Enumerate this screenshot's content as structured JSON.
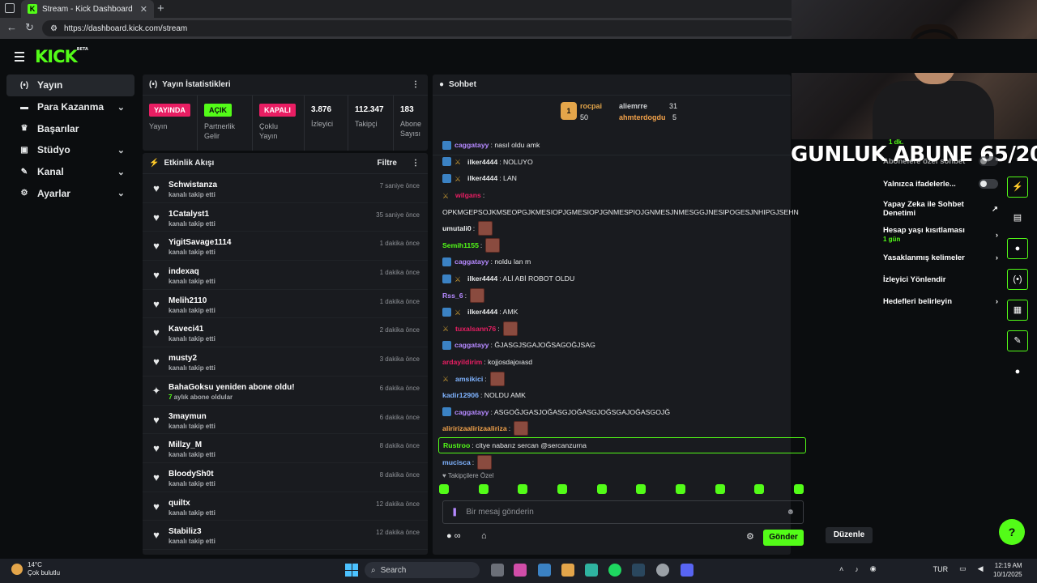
{
  "browser": {
    "tab_title": "Stream - Kick Dashboard",
    "url": "https://dashboard.kick.com/stream"
  },
  "logo": {
    "text": "KICK",
    "superscript": "BETA"
  },
  "sidebar": {
    "items": [
      {
        "label": "Yayın",
        "icon": "broadcast-icon",
        "chevron": false,
        "active": true
      },
      {
        "label": "Para Kazanma",
        "icon": "money-icon",
        "chevron": true
      },
      {
        "label": "Başarılar",
        "icon": "trophy-icon",
        "chevron": false
      },
      {
        "label": "Stüdyo",
        "icon": "studio-icon",
        "chevron": true
      },
      {
        "label": "Kanal",
        "icon": "channel-icon",
        "chevron": true
      },
      {
        "label": "Ayarlar",
        "icon": "gear-icon",
        "chevron": true
      }
    ]
  },
  "stats": {
    "title": "Yayın İstatistikleri",
    "cells": [
      {
        "pill": "YAYINDA",
        "pill_color": "red",
        "label": "Yayın"
      },
      {
        "pill": "AÇIK",
        "pill_color": "green",
        "label": "Partnerlik Gelir"
      },
      {
        "pill": "KAPALI",
        "pill_color": "red",
        "label": "Çoklu Yayın"
      },
      {
        "value": "3.876",
        "label": "İzleyici"
      },
      {
        "value": "112.347",
        "label": "Takipçi"
      },
      {
        "value": "183",
        "label": "Abone Sayısı"
      }
    ]
  },
  "activity": {
    "title": "Etkinlik Akışı",
    "filter_label": "Filtre",
    "items": [
      {
        "name": "Schwistanza",
        "sub": "kanalı takip etti",
        "time": "7 saniye önce",
        "icon": "heart-icon"
      },
      {
        "name": "1Catalyst1",
        "sub": "kanalı takip etti",
        "time": "35 saniye önce",
        "icon": "heart-icon"
      },
      {
        "name": "YigitSavage1114",
        "sub": "kanalı takip etti",
        "time": "1 dakika önce",
        "icon": "heart-icon"
      },
      {
        "name": "indexaq",
        "sub": "kanalı takip etti",
        "time": "1 dakika önce",
        "icon": "heart-icon"
      },
      {
        "name": "Melih2110",
        "sub": "kanalı takip etti",
        "time": "1 dakika önce",
        "icon": "heart-icon"
      },
      {
        "name": "Kaveci41",
        "sub": "kanalı takip etti",
        "time": "2 dakika önce",
        "icon": "heart-icon"
      },
      {
        "name": "musty2",
        "sub": "kanalı takip etti",
        "time": "3 dakika önce",
        "icon": "heart-icon"
      },
      {
        "name": "BahaGoksu yeniden abone oldu!",
        "sub_num": "7",
        "sub": " aylık abone oldular",
        "time": "6 dakika önce",
        "icon": "star-icon"
      },
      {
        "name": "3maymun",
        "sub": "kanalı takip etti",
        "time": "6 dakika önce",
        "icon": "heart-icon"
      },
      {
        "name": "Millzy_M",
        "sub": "kanalı takip etti",
        "time": "8 dakika önce",
        "icon": "heart-icon"
      },
      {
        "name": "BloodySh0t",
        "sub": "kanalı takip etti",
        "time": "8 dakika önce",
        "icon": "heart-icon"
      },
      {
        "name": "quiltx",
        "sub": "kanalı takip etti",
        "time": "12 dakika önce",
        "icon": "heart-icon"
      },
      {
        "name": "Stabiliz3",
        "sub": "kanalı takip etti",
        "time": "12 dakika önce",
        "icon": "heart-icon"
      }
    ]
  },
  "chat": {
    "title": "Sohbet",
    "leaderboard": [
      {
        "rank": "1",
        "name": "rocpai",
        "value": "50"
      },
      {
        "name": "aliemrre",
        "value": "31"
      },
      {
        "name": "ahmterdogdu",
        "value": "5"
      }
    ],
    "messages": [
      {
        "user": "caggatayy",
        "color": "#b589ff",
        "text": ": nasıl oldu amk",
        "badge": true
      },
      {
        "user": "ilker4444",
        "color": "#e7e9ea",
        "text": ": NOLUYO",
        "badge": true,
        "badge2": true
      },
      {
        "user": "ilker4444",
        "color": "#e7e9ea",
        "text": ": LAN",
        "badge": true,
        "badge2": true
      },
      {
        "user": "wilgans",
        "color": "#e91e63",
        "text": ":",
        "badge2": true
      },
      {
        "user": "",
        "color": "#e7e9ea",
        "text": "OPKMGEPSOJKMSEOPGJKMESIOPJGMESIOPJGNMESPIOJGNMESJNMESGGJNESIPOGESJNHIPGJSEHN"
      },
      {
        "user": "umutali0",
        "color": "#e7e9ea",
        "text": ":",
        "emote": true
      },
      {
        "user": "Semih1155",
        "color": "#53fc18",
        "text": ":",
        "emote": true
      },
      {
        "user": "caggatayy",
        "color": "#b589ff",
        "text": ": noldu lan m",
        "badge": true
      },
      {
        "user": "ilker4444",
        "color": "#e7e9ea",
        "text": ": ALİ ABİ ROBOT OLDU",
        "badge": true,
        "badge2": true
      },
      {
        "user": "Rss_6",
        "color": "#b589ff",
        "text": ":",
        "emote": true
      },
      {
        "user": "ilker4444",
        "color": "#e7e9ea",
        "text": ": AMK",
        "badge": true,
        "badge2": true
      },
      {
        "user": "tuxalsann76",
        "color": "#e91e63",
        "text": ":",
        "badge2": true,
        "emote": true
      },
      {
        "user": "caggatayy",
        "color": "#b589ff",
        "text": ": ĞJASGJSGAJOĞSAGOĞJSAG",
        "badge": true
      },
      {
        "user": "ardayildirim",
        "color": "#e91e63",
        "text": ": kojjosdajoıasd"
      },
      {
        "user": "amsikici",
        "color": "#7fb3ff",
        "text": ":",
        "badge2": true,
        "emote": true
      },
      {
        "user": "kadir12906",
        "color": "#7fb3ff",
        "text": ": NOLDU AMK"
      },
      {
        "user": "caggatayy",
        "color": "#b589ff",
        "text": ": ASGOĞJGASJOĞASGJOĞASGJOĞSGAJOĞASGOJĞ",
        "badge": true
      },
      {
        "user": "aliririzaalirizaaliriza",
        "color": "#f2a24a",
        "text": ":",
        "emote": true
      },
      {
        "user": "Rustroo",
        "color": "#53fc18",
        "text": ": cityе nabarız sercan @sercanzurna",
        "highlight": true
      },
      {
        "user": "mucisca",
        "color": "#7fb3ff",
        "text": ":",
        "emote": true
      }
    ],
    "follower_label": "Takipçilere Özel",
    "input_placeholder": "Bir mesaj gönderin",
    "send_label": "Gönder"
  },
  "right_panel": {
    "overlay_text": "GUNLUK ABUNE 65/20",
    "dk": "1 dk.",
    "items": [
      {
        "label": "Abonelere özel sohbet",
        "control": "toggle"
      },
      {
        "label": "Yalnızca ifadelerle...",
        "control": "toggle"
      },
      {
        "label": "Yapay Zeka ile Sohbet Denetimi",
        "control": "external"
      },
      {
        "label": "Hesap yaşı kısıtlaması",
        "sub": "1 gün",
        "control": "chevron"
      },
      {
        "label": "Yasaklanmış kelimeler",
        "control": "chevron"
      },
      {
        "label": "İzleyici Yönlendir",
        "control": "none"
      },
      {
        "label": "Hedefleri belirleyin",
        "control": "chevron"
      }
    ],
    "edit_label": "Düzenle"
  },
  "taskbar": {
    "temp": "14°C",
    "weather": "Çok bulutlu",
    "search": "Search",
    "lang": "TUR",
    "time": "12:19 AM",
    "date": "10/1/2025"
  },
  "colors": {
    "accent": "#53fc18",
    "live": "#e91e63",
    "panel": "#191b1f",
    "bg": "#0b0d0f"
  }
}
